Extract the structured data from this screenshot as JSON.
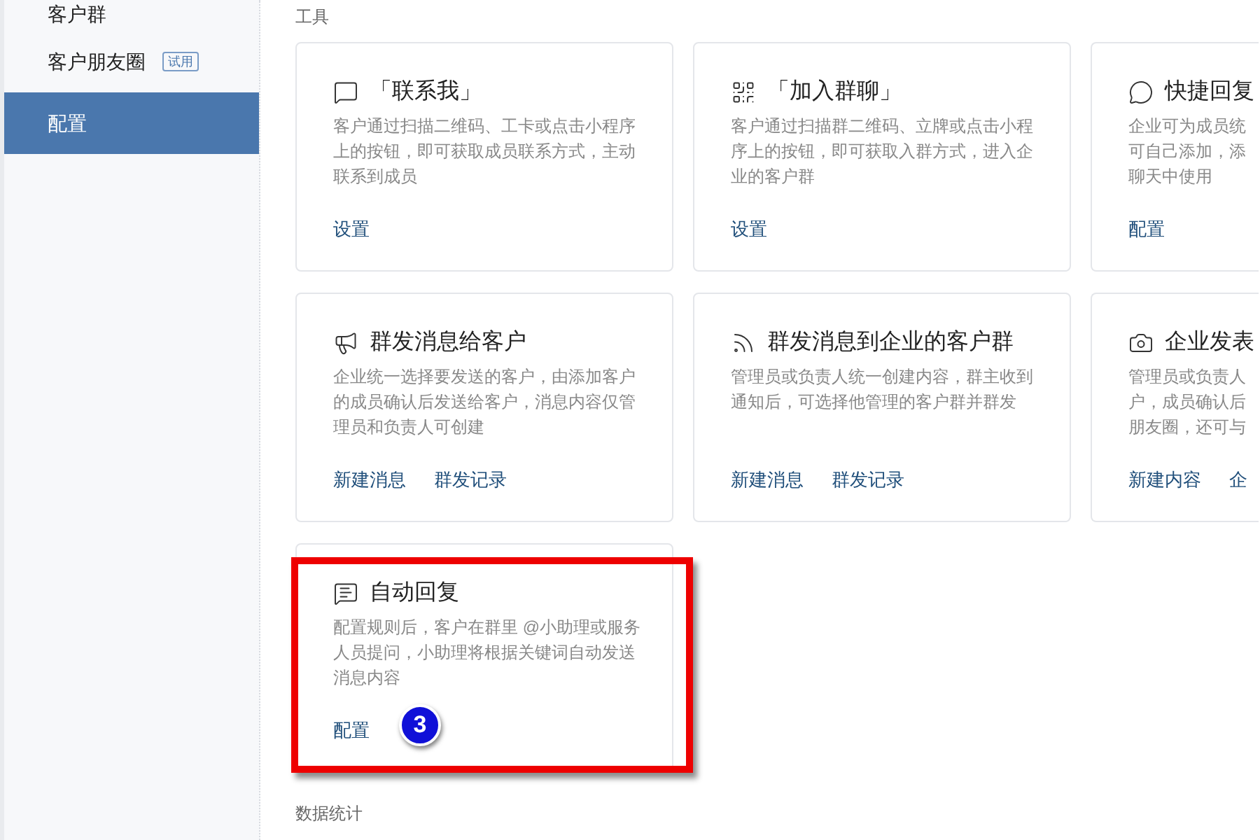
{
  "sidebar": {
    "items": [
      {
        "label": "客户群",
        "selected": false
      },
      {
        "label": "客户朋友圈",
        "badge": "试用",
        "selected": false
      },
      {
        "label": "配置",
        "selected": true
      }
    ]
  },
  "tools": {
    "heading": "工具",
    "cards": [
      {
        "title": "「联系我」",
        "description": "客户通过扫描二维码、工卡或点击小程序上的按钮，即可获取成员联系方式，主动联系到成员",
        "links": [
          "设置"
        ]
      },
      {
        "title": "「加入群聊」",
        "description": "客户通过扫描群二维码、立牌或点击小程序上的按钮，即可获取入群方式，进入企业的客户群",
        "links": [
          "设置"
        ]
      },
      {
        "title": "快捷回复",
        "description_lines": [
          "企业可为成员统",
          "可自己添加，添",
          "聊天中使用"
        ],
        "links": [
          "配置"
        ]
      },
      {
        "title": "群发消息给客户",
        "description": "企业统一选择要发送的客户，由添加客户的成员确认后发送给客户，消息内容仅管理员和负责人可创建",
        "links": [
          "新建消息",
          "群发记录"
        ]
      },
      {
        "title": "群发消息到企业的客户群",
        "description": "管理员或负责人统一创建内容，群主收到通知后，可选择他管理的客户群并群发",
        "links": [
          "新建消息",
          "群发记录"
        ]
      },
      {
        "title": "企业发表",
        "description_lines": [
          "管理员或负责人",
          "户，成员确认后",
          "朋友圈，还可与"
        ],
        "links": [
          "新建内容",
          "企"
        ]
      },
      {
        "title": "自动回复",
        "description": "配置规则后，客户在群里 @小助理或服务人员提问，小助理将根据关键词自动发送消息内容",
        "links": [
          "配置"
        ],
        "highlighted": true,
        "marker": "3"
      }
    ]
  },
  "stats": {
    "heading": "数据统计"
  }
}
